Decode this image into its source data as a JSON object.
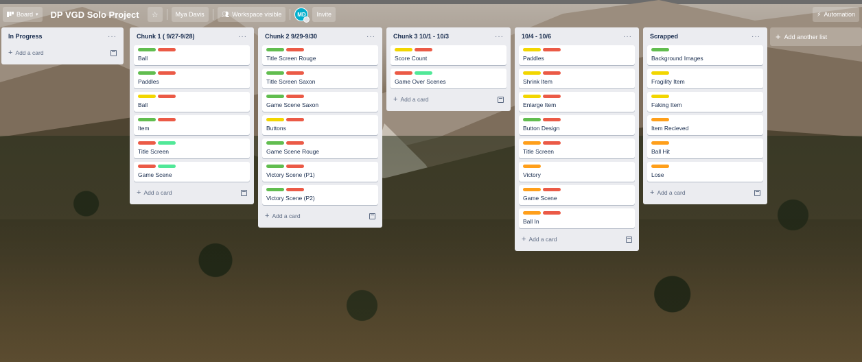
{
  "header": {
    "view_label": "Board",
    "title": "DP VGD Solo Project",
    "member_name": "Mya Davis",
    "visibility_label": "Workspace visible",
    "avatar_initials": "MD",
    "invite_label": "Invite",
    "automation_label": "Automation"
  },
  "label_colors": {
    "green": "#61bd4f",
    "red": "#eb5a46",
    "yellow": "#f2d600",
    "orange": "#ff9f1a",
    "lime": "#51e898"
  },
  "lists": [
    {
      "title": "In Progress",
      "add_label": "Add a card",
      "cards": []
    },
    {
      "title": "Chunk 1 ( 9/27-9/28)",
      "add_label": "Add a card",
      "cards": [
        {
          "title": "Ball",
          "labels": [
            "green",
            "red"
          ]
        },
        {
          "title": "Paddles",
          "labels": [
            "green",
            "red"
          ]
        },
        {
          "title": "Ball",
          "labels": [
            "yellow",
            "red"
          ]
        },
        {
          "title": "Item",
          "labels": [
            "green",
            "red"
          ]
        },
        {
          "title": "Title Screen",
          "labels": [
            "red",
            "lime"
          ]
        },
        {
          "title": "Game Scene",
          "labels": [
            "red",
            "lime"
          ]
        }
      ]
    },
    {
      "title": "Chunk 2 9/29-9/30",
      "add_label": "Add a card",
      "cards": [
        {
          "title": "Title Screen Rouge",
          "labels": [
            "green",
            "red"
          ]
        },
        {
          "title": "Title Screen Saxon",
          "labels": [
            "green",
            "red"
          ]
        },
        {
          "title": "Game Scene Saxon",
          "labels": [
            "green",
            "red"
          ]
        },
        {
          "title": "Buttons",
          "labels": [
            "yellow",
            "red"
          ]
        },
        {
          "title": "Game Scene Rouge",
          "labels": [
            "green",
            "red"
          ]
        },
        {
          "title": "Victory Scene (P1)",
          "labels": [
            "green",
            "red"
          ]
        },
        {
          "title": "Victory Scene (P2)",
          "labels": [
            "green",
            "red"
          ]
        }
      ]
    },
    {
      "title": "Chunk 3 10/1 - 10/3",
      "add_label": "Add a card",
      "cards": [
        {
          "title": "Score Count",
          "labels": [
            "yellow",
            "red"
          ]
        },
        {
          "title": "Game Over Scenes",
          "labels": [
            "red",
            "lime"
          ]
        }
      ]
    },
    {
      "title": "10/4 - 10/6",
      "add_label": "Add a card",
      "cards": [
        {
          "title": "Paddles",
          "labels": [
            "yellow",
            "red"
          ]
        },
        {
          "title": "Shrink Item",
          "labels": [
            "yellow",
            "red"
          ]
        },
        {
          "title": "Enlarge Item",
          "labels": [
            "yellow",
            "red"
          ]
        },
        {
          "title": "Button Design",
          "labels": [
            "green",
            "red"
          ]
        },
        {
          "title": "Title Screen",
          "labels": [
            "orange",
            "red"
          ]
        },
        {
          "title": "Victory",
          "labels": [
            "orange"
          ]
        },
        {
          "title": "Game Scene",
          "labels": [
            "orange",
            "red"
          ]
        },
        {
          "title": "Ball In",
          "labels": [
            "orange",
            "red"
          ]
        }
      ]
    },
    {
      "title": "Scrapped",
      "add_label": "Add a card",
      "cards": [
        {
          "title": "Background Images",
          "labels": [
            "green"
          ]
        },
        {
          "title": "Fragility Item",
          "labels": [
            "yellow"
          ]
        },
        {
          "title": "Faking Item",
          "labels": [
            "yellow"
          ]
        },
        {
          "title": "Item Recieved",
          "labels": [
            "orange"
          ]
        },
        {
          "title": "Ball Hit",
          "labels": [
            "orange"
          ]
        },
        {
          "title": "Lose",
          "labels": [
            "orange"
          ]
        }
      ]
    }
  ],
  "add_list_label": "Add another list"
}
